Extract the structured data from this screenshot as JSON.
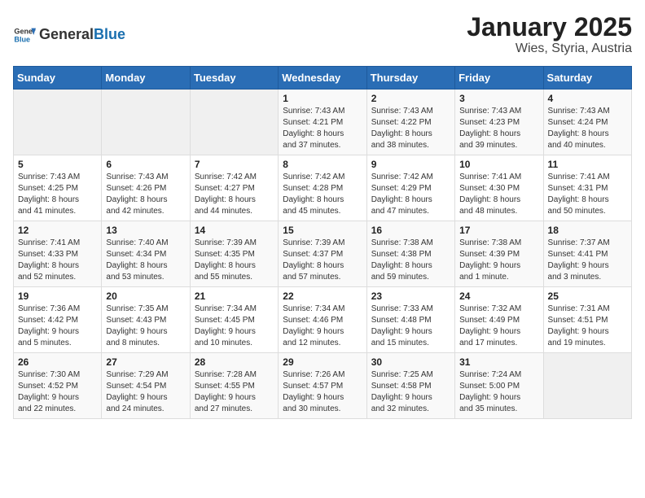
{
  "header": {
    "logo_general": "General",
    "logo_blue": "Blue",
    "title": "January 2025",
    "subtitle": "Wies, Styria, Austria"
  },
  "weekdays": [
    "Sunday",
    "Monday",
    "Tuesday",
    "Wednesday",
    "Thursday",
    "Friday",
    "Saturday"
  ],
  "weeks": [
    [
      {
        "day": "",
        "info": ""
      },
      {
        "day": "",
        "info": ""
      },
      {
        "day": "",
        "info": ""
      },
      {
        "day": "1",
        "info": "Sunrise: 7:43 AM\nSunset: 4:21 PM\nDaylight: 8 hours\nand 37 minutes."
      },
      {
        "day": "2",
        "info": "Sunrise: 7:43 AM\nSunset: 4:22 PM\nDaylight: 8 hours\nand 38 minutes."
      },
      {
        "day": "3",
        "info": "Sunrise: 7:43 AM\nSunset: 4:23 PM\nDaylight: 8 hours\nand 39 minutes."
      },
      {
        "day": "4",
        "info": "Sunrise: 7:43 AM\nSunset: 4:24 PM\nDaylight: 8 hours\nand 40 minutes."
      }
    ],
    [
      {
        "day": "5",
        "info": "Sunrise: 7:43 AM\nSunset: 4:25 PM\nDaylight: 8 hours\nand 41 minutes."
      },
      {
        "day": "6",
        "info": "Sunrise: 7:43 AM\nSunset: 4:26 PM\nDaylight: 8 hours\nand 42 minutes."
      },
      {
        "day": "7",
        "info": "Sunrise: 7:42 AM\nSunset: 4:27 PM\nDaylight: 8 hours\nand 44 minutes."
      },
      {
        "day": "8",
        "info": "Sunrise: 7:42 AM\nSunset: 4:28 PM\nDaylight: 8 hours\nand 45 minutes."
      },
      {
        "day": "9",
        "info": "Sunrise: 7:42 AM\nSunset: 4:29 PM\nDaylight: 8 hours\nand 47 minutes."
      },
      {
        "day": "10",
        "info": "Sunrise: 7:41 AM\nSunset: 4:30 PM\nDaylight: 8 hours\nand 48 minutes."
      },
      {
        "day": "11",
        "info": "Sunrise: 7:41 AM\nSunset: 4:31 PM\nDaylight: 8 hours\nand 50 minutes."
      }
    ],
    [
      {
        "day": "12",
        "info": "Sunrise: 7:41 AM\nSunset: 4:33 PM\nDaylight: 8 hours\nand 52 minutes."
      },
      {
        "day": "13",
        "info": "Sunrise: 7:40 AM\nSunset: 4:34 PM\nDaylight: 8 hours\nand 53 minutes."
      },
      {
        "day": "14",
        "info": "Sunrise: 7:39 AM\nSunset: 4:35 PM\nDaylight: 8 hours\nand 55 minutes."
      },
      {
        "day": "15",
        "info": "Sunrise: 7:39 AM\nSunset: 4:37 PM\nDaylight: 8 hours\nand 57 minutes."
      },
      {
        "day": "16",
        "info": "Sunrise: 7:38 AM\nSunset: 4:38 PM\nDaylight: 8 hours\nand 59 minutes."
      },
      {
        "day": "17",
        "info": "Sunrise: 7:38 AM\nSunset: 4:39 PM\nDaylight: 9 hours\nand 1 minute."
      },
      {
        "day": "18",
        "info": "Sunrise: 7:37 AM\nSunset: 4:41 PM\nDaylight: 9 hours\nand 3 minutes."
      }
    ],
    [
      {
        "day": "19",
        "info": "Sunrise: 7:36 AM\nSunset: 4:42 PM\nDaylight: 9 hours\nand 5 minutes."
      },
      {
        "day": "20",
        "info": "Sunrise: 7:35 AM\nSunset: 4:43 PM\nDaylight: 9 hours\nand 8 minutes."
      },
      {
        "day": "21",
        "info": "Sunrise: 7:34 AM\nSunset: 4:45 PM\nDaylight: 9 hours\nand 10 minutes."
      },
      {
        "day": "22",
        "info": "Sunrise: 7:34 AM\nSunset: 4:46 PM\nDaylight: 9 hours\nand 12 minutes."
      },
      {
        "day": "23",
        "info": "Sunrise: 7:33 AM\nSunset: 4:48 PM\nDaylight: 9 hours\nand 15 minutes."
      },
      {
        "day": "24",
        "info": "Sunrise: 7:32 AM\nSunset: 4:49 PM\nDaylight: 9 hours\nand 17 minutes."
      },
      {
        "day": "25",
        "info": "Sunrise: 7:31 AM\nSunset: 4:51 PM\nDaylight: 9 hours\nand 19 minutes."
      }
    ],
    [
      {
        "day": "26",
        "info": "Sunrise: 7:30 AM\nSunset: 4:52 PM\nDaylight: 9 hours\nand 22 minutes."
      },
      {
        "day": "27",
        "info": "Sunrise: 7:29 AM\nSunset: 4:54 PM\nDaylight: 9 hours\nand 24 minutes."
      },
      {
        "day": "28",
        "info": "Sunrise: 7:28 AM\nSunset: 4:55 PM\nDaylight: 9 hours\nand 27 minutes."
      },
      {
        "day": "29",
        "info": "Sunrise: 7:26 AM\nSunset: 4:57 PM\nDaylight: 9 hours\nand 30 minutes."
      },
      {
        "day": "30",
        "info": "Sunrise: 7:25 AM\nSunset: 4:58 PM\nDaylight: 9 hours\nand 32 minutes."
      },
      {
        "day": "31",
        "info": "Sunrise: 7:24 AM\nSunset: 5:00 PM\nDaylight: 9 hours\nand 35 minutes."
      },
      {
        "day": "",
        "info": ""
      }
    ]
  ]
}
